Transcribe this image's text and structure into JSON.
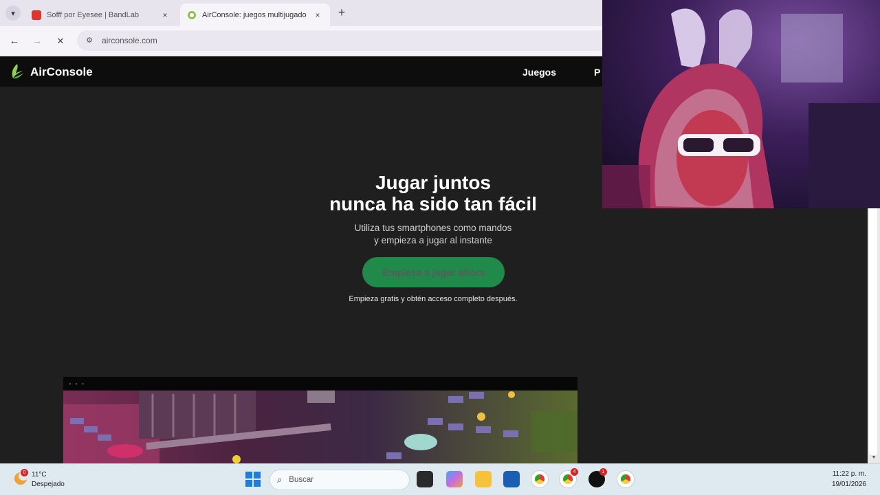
{
  "browser": {
    "tabs": [
      {
        "title": "Sofff por Eyesee | BandLab",
        "active": false
      },
      {
        "title": "AirConsole: juegos multijugado",
        "active": true
      }
    ],
    "tab_close": "×",
    "new_tab": "+",
    "back": "←",
    "forward": "→",
    "stop": "✕",
    "site_info": "⚙",
    "url": "airconsole.com"
  },
  "site": {
    "logo_text": "AirConsole",
    "nav": [
      "Juegos",
      "P"
    ],
    "hero": {
      "title_line1": "Jugar juntos",
      "title_line2": "nunca ha sido tan fácil",
      "subtitle_line1": "Utiliza tus smartphones como mandos",
      "subtitle_line2": "y empieza a jugar al instante",
      "cta": "Empieza a jugar ahora",
      "note": "Empieza gratis y obtén acceso completo después."
    },
    "preview_dots": "● ● ●"
  },
  "taskbar": {
    "weather_temp": "11°C",
    "weather_desc": "Despejado",
    "search_placeholder": "Buscar",
    "badges": [
      "0",
      "4",
      "1"
    ],
    "clock_time": "11:22 p. m.",
    "clock_date": "19/01/2026"
  },
  "colors": {
    "accent_green": "#1f8a4a",
    "site_bg": "#1f1f1f",
    "header_bg": "#0d0d0d"
  }
}
